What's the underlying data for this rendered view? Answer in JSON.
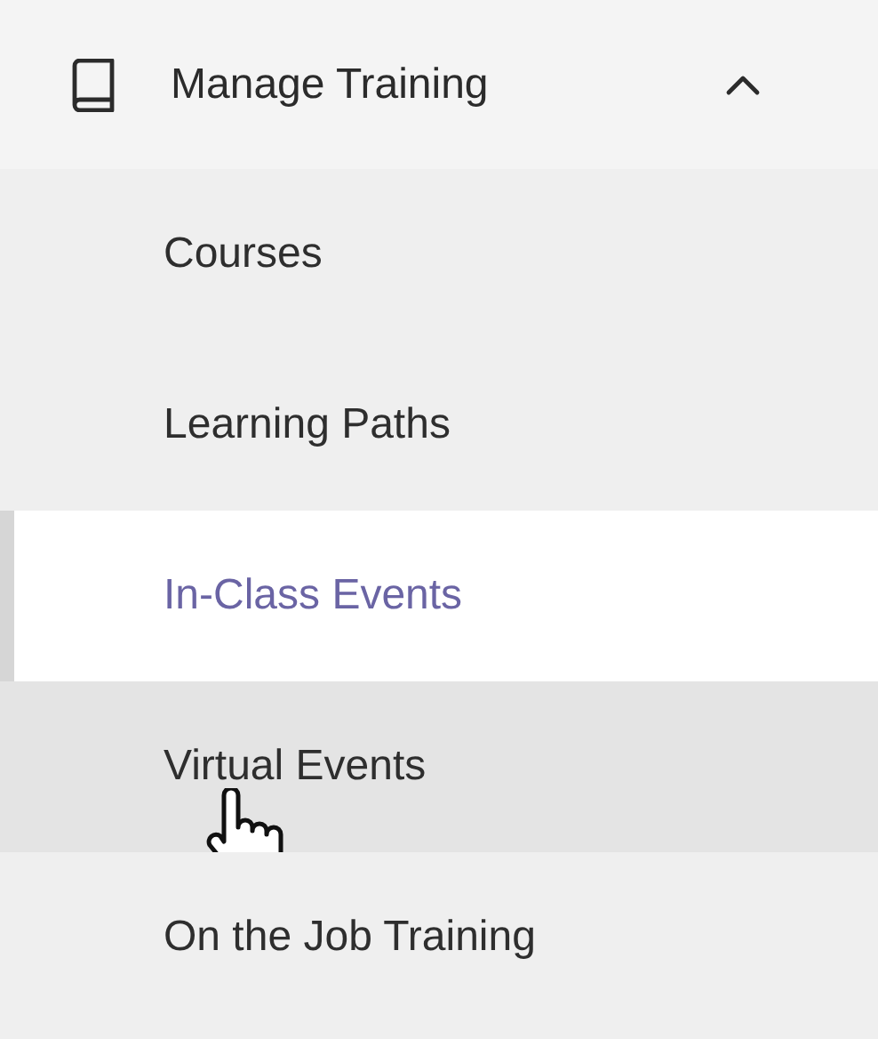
{
  "menu": {
    "title": "Manage Training",
    "expanded": true,
    "items": [
      {
        "label": "Courses",
        "selected": false,
        "hovered": false
      },
      {
        "label": "Learning Paths",
        "selected": false,
        "hovered": false
      },
      {
        "label": "In-Class Events",
        "selected": true,
        "hovered": false
      },
      {
        "label": "Virtual Events",
        "selected": false,
        "hovered": true
      },
      {
        "label": "On the Job Training",
        "selected": false,
        "hovered": false
      }
    ]
  }
}
